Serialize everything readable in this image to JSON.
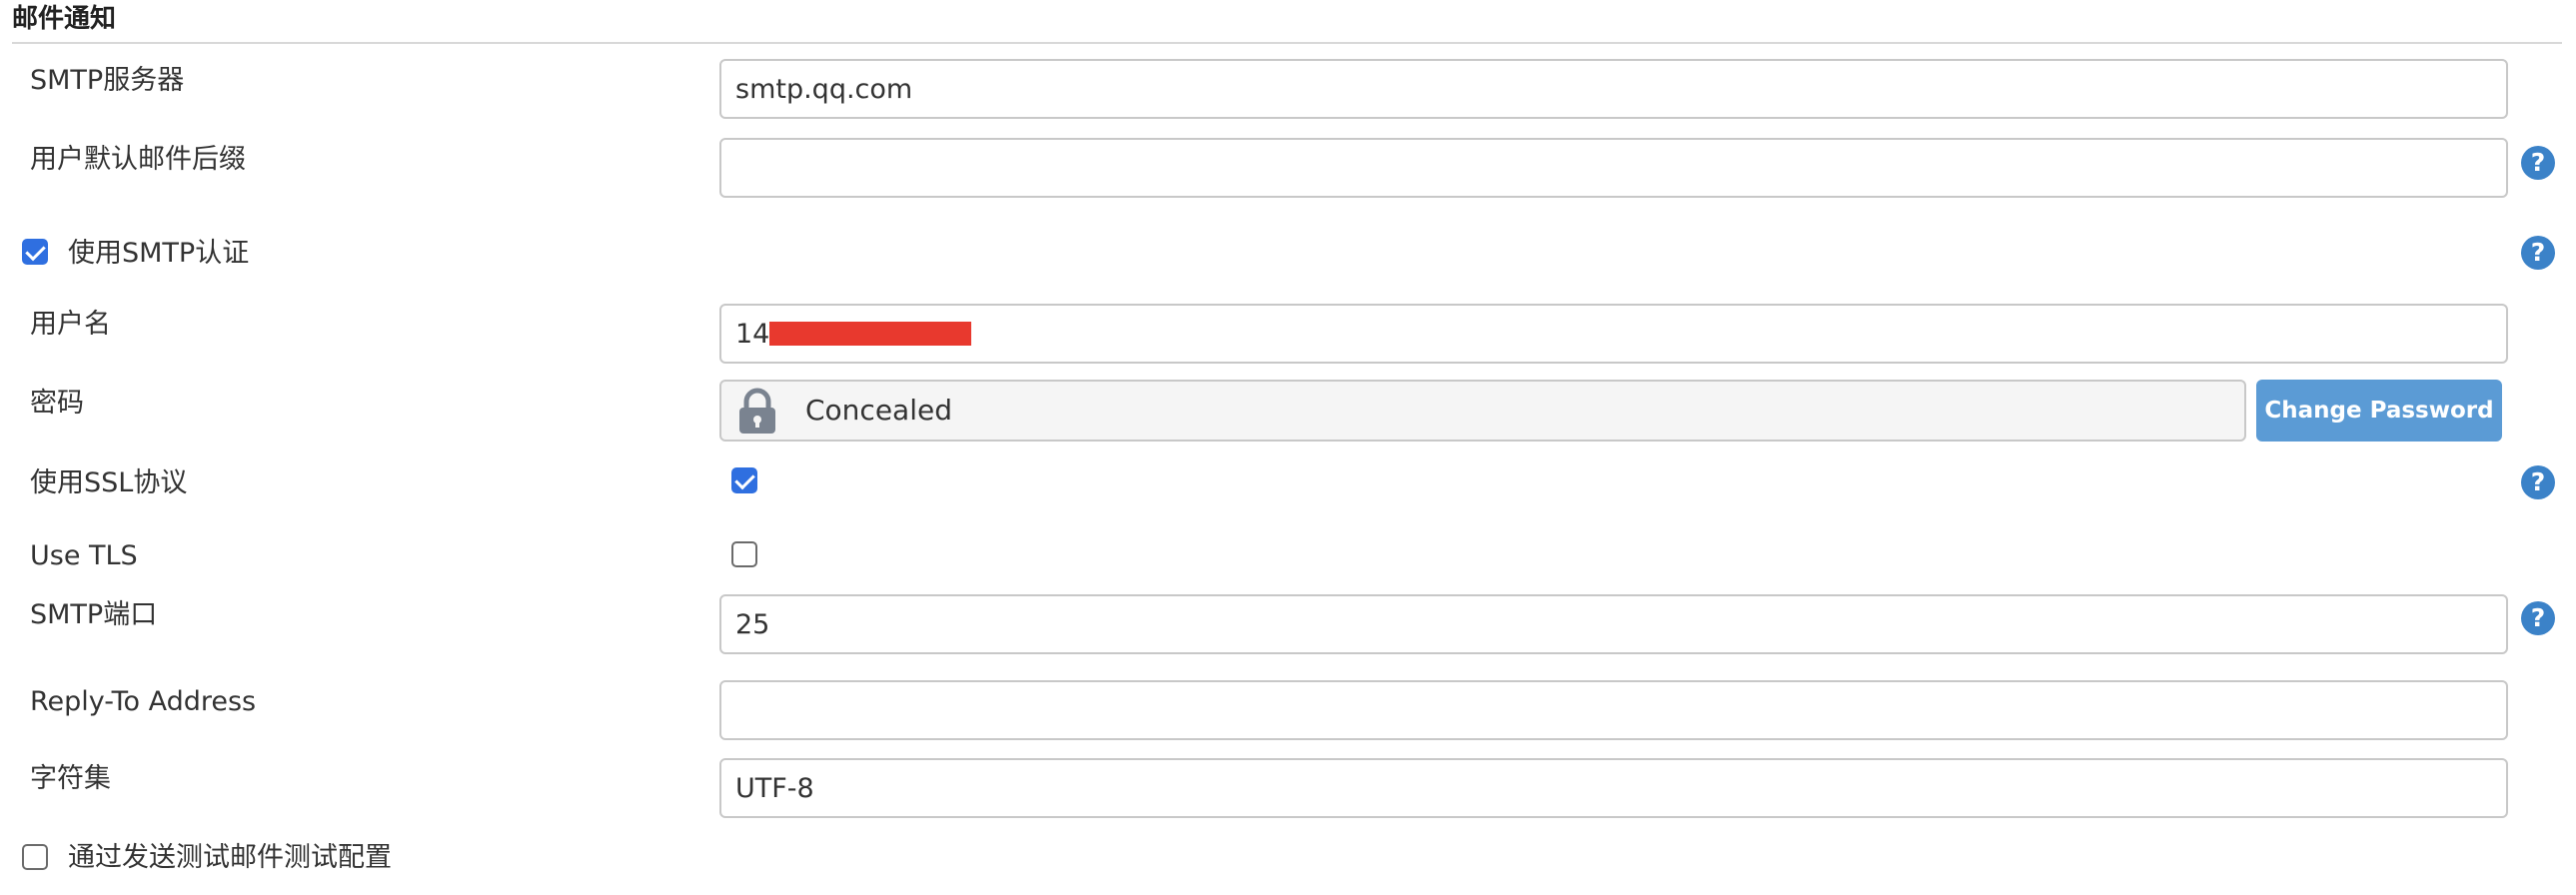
{
  "section": {
    "title": "邮件通知"
  },
  "fields": {
    "smtp_server": {
      "label": "SMTP服务器",
      "value": "smtp.qq.com"
    },
    "default_suffix": {
      "label": "用户默认邮件后缀",
      "value": ""
    },
    "use_smtp_auth": {
      "label": "使用SMTP认证",
      "checked": true
    },
    "username": {
      "label": "用户名",
      "value": "148            com"
    },
    "password": {
      "label": "密码",
      "concealed_text": "Concealed",
      "change_button": "Change Password"
    },
    "use_ssl": {
      "label": "使用SSL协议",
      "checked": true
    },
    "use_tls": {
      "label": "Use TLS",
      "checked": false
    },
    "smtp_port": {
      "label": "SMTP端口",
      "value": "25"
    },
    "reply_to": {
      "label": "Reply-To Address",
      "value": ""
    },
    "charset": {
      "label": "字符集",
      "value": "UTF-8"
    },
    "test_config": {
      "label": "通过发送测试邮件测试配置",
      "checked": false
    }
  },
  "help_icon": {
    "glyph": "?"
  },
  "colors": {
    "accent": "#3b82c8",
    "checkbox_checked": "#2f6fe0",
    "button": "#5b9bd5",
    "redaction": "#e8392e"
  },
  "icons": {
    "help": "help-icon",
    "lock": "lock-icon"
  }
}
